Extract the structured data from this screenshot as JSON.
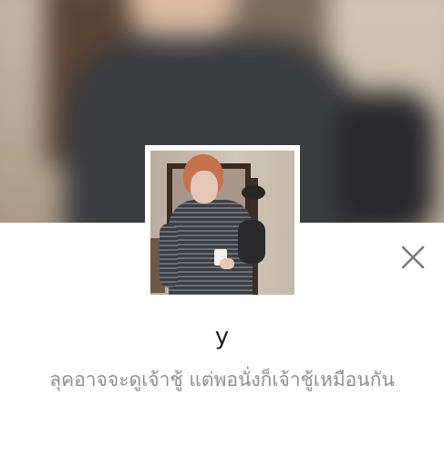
{
  "profile": {
    "name": "y",
    "status_message": "ลุคอาจจะดูเจ้าชู้ แต่พอนั่งก็เจ้าชู้เหมือนกัน"
  },
  "icons": {
    "close": "close-icon"
  },
  "colors": {
    "name_text": "#1f1f1f",
    "status_text": "#8f8f8f",
    "close_icon": "#7a7a7a",
    "background": "#ffffff"
  }
}
